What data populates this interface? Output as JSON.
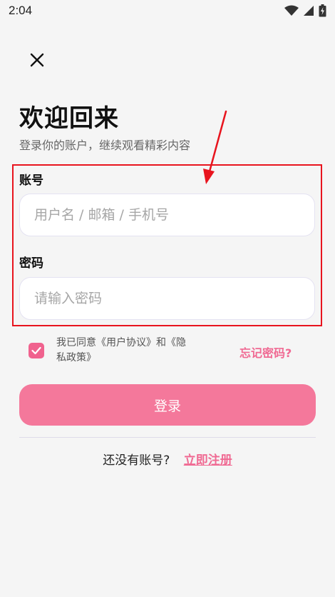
{
  "status_bar": {
    "time": "2:04"
  },
  "header": {
    "title": "欢迎回来",
    "subtitle": "登录你的账户，继续观看精彩内容"
  },
  "form": {
    "account_label": "账号",
    "account_placeholder": "用户名 / 邮箱 / 手机号",
    "password_label": "密码",
    "password_placeholder": "请输入密码"
  },
  "agreement": {
    "checked": true,
    "text": "我已同意《用户协议》和《隐私政策》"
  },
  "forgot_label": "忘记密码?",
  "login_label": "登录",
  "register": {
    "prompt": "还没有账号?",
    "link_label": "立即注册"
  },
  "colors": {
    "accent": "#f06a93",
    "button": "#f4789b",
    "highlight": "#e8141e",
    "annotation_arrow": "#e8141e"
  }
}
